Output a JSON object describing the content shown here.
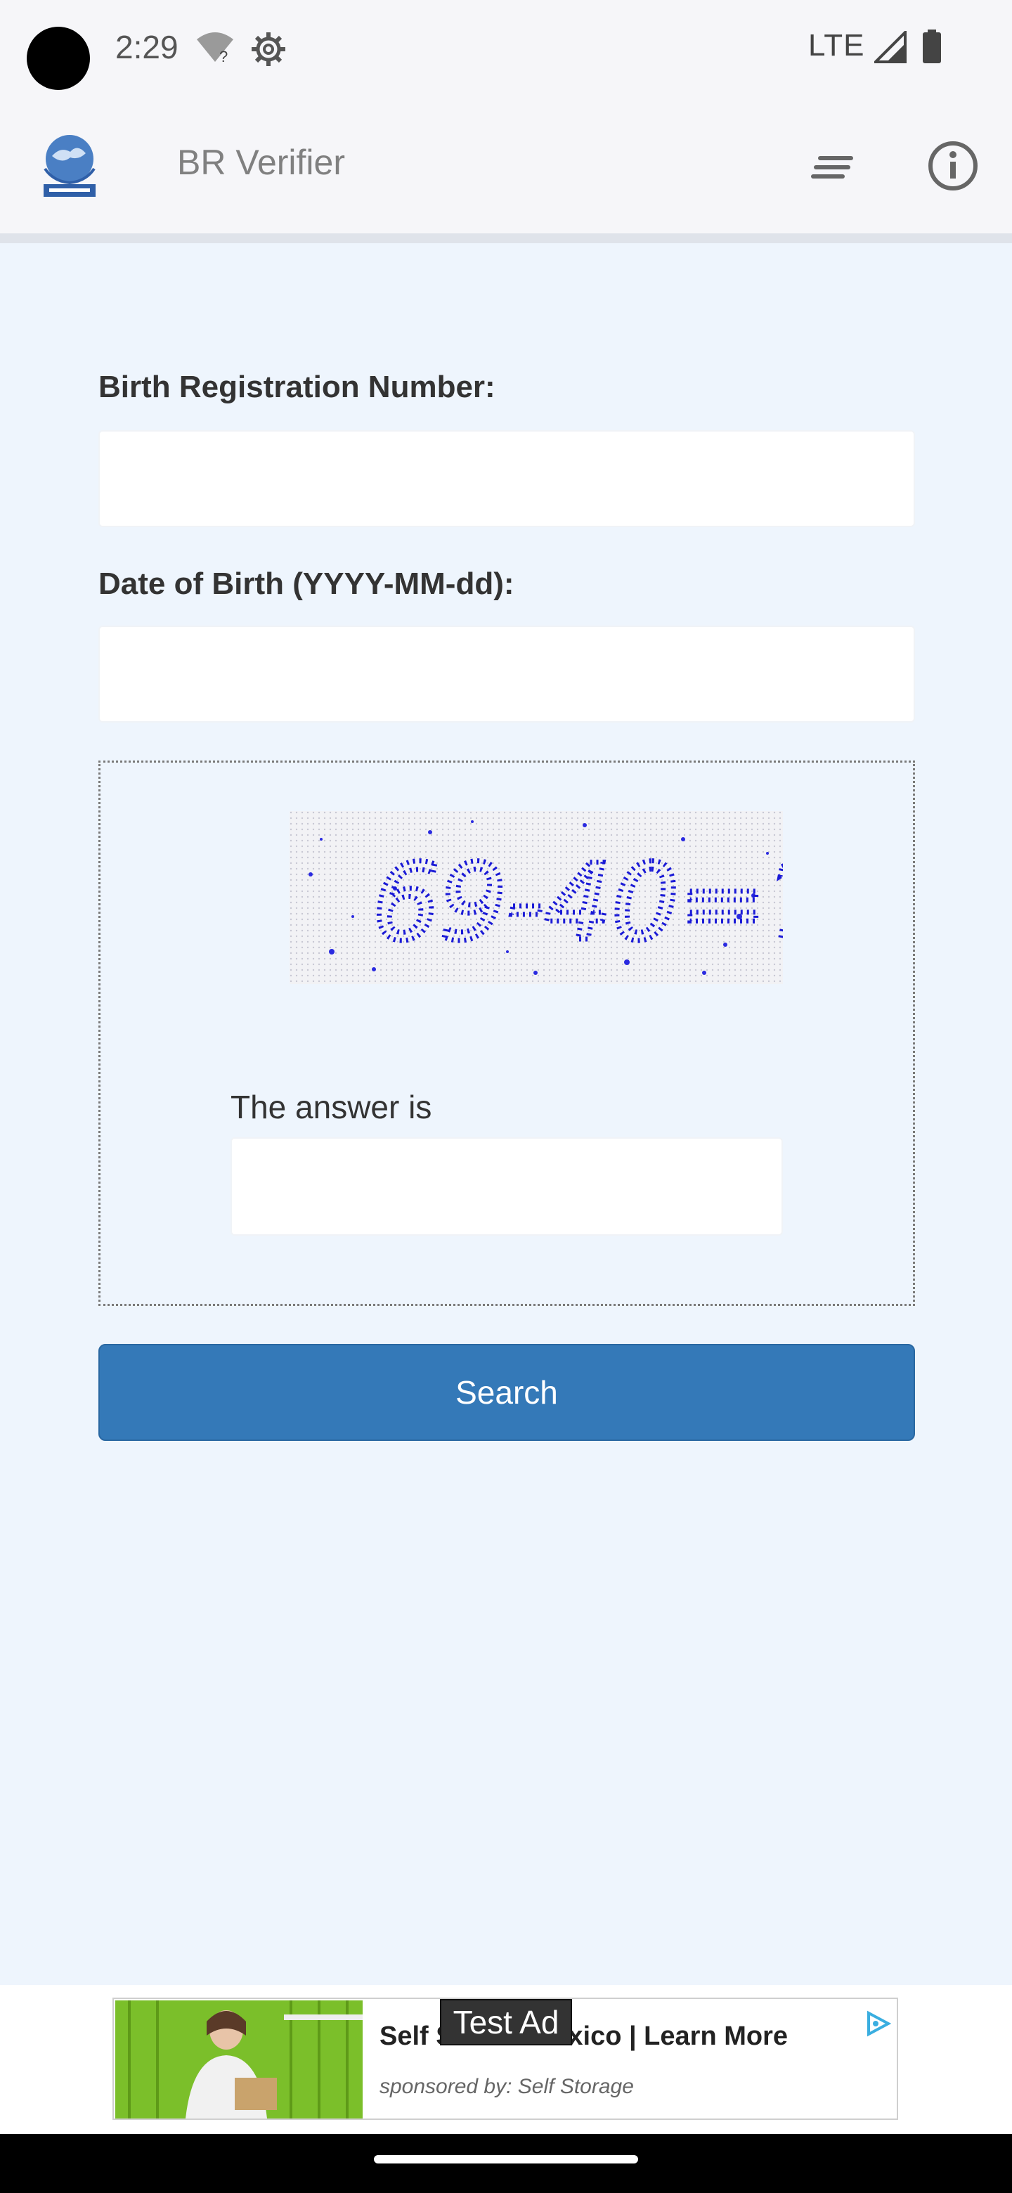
{
  "status_bar": {
    "time": "2:29",
    "network": "LTE",
    "icons": [
      "wifi-unknown-icon",
      "settings-gear-icon",
      "signal-icon",
      "battery-icon"
    ]
  },
  "app_bar": {
    "title": "BR Verifier",
    "icons": [
      "app-logo-icon",
      "menu-icon",
      "info-icon"
    ]
  },
  "form": {
    "brn_label": "Birth Registration Number:",
    "brn_value": "",
    "dob_label": "Date of Birth (YYYY-MM-dd):",
    "dob_value": "",
    "captcha_text": "69-40=?",
    "answer_label": "The answer is",
    "answer_value": "",
    "search_label": "Search"
  },
  "ad": {
    "badge": "Test Ad",
    "title_left": "Self S",
    "title_right": "Mexico | Learn More",
    "sponsor": "sponsored by: Self Storage"
  },
  "colors": {
    "background": "#eef5fd",
    "button": "#3479b8",
    "captcha_text": "#1a1ad6"
  }
}
